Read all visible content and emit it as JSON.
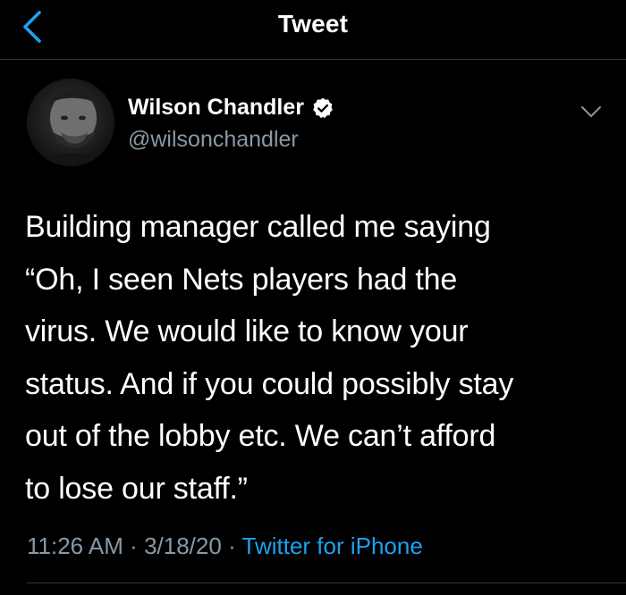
{
  "header": {
    "title": "Tweet",
    "back_icon": "chevron-left-icon"
  },
  "colors": {
    "background": "#000000",
    "accent": "#1da1f2",
    "secondary_text": "#8899a6",
    "divider": "#2f3336"
  },
  "tweet": {
    "author": {
      "display_name": "Wilson Chandler",
      "handle": "@wilsonchandler",
      "verified_icon": "verified-badge-icon"
    },
    "text_lines": [
      "Building manager called me saying",
      "“Oh, I seen Nets players had the",
      "virus. We would like to know your",
      "status. And if you could possibly stay",
      "out of the lobby etc. We can’t afford",
      "to lose our staff.”"
    ],
    "time": "11:26 AM",
    "date": "3/18/20",
    "separator": "·",
    "source": "Twitter for iPhone",
    "menu_icon": "chevron-down-icon"
  }
}
